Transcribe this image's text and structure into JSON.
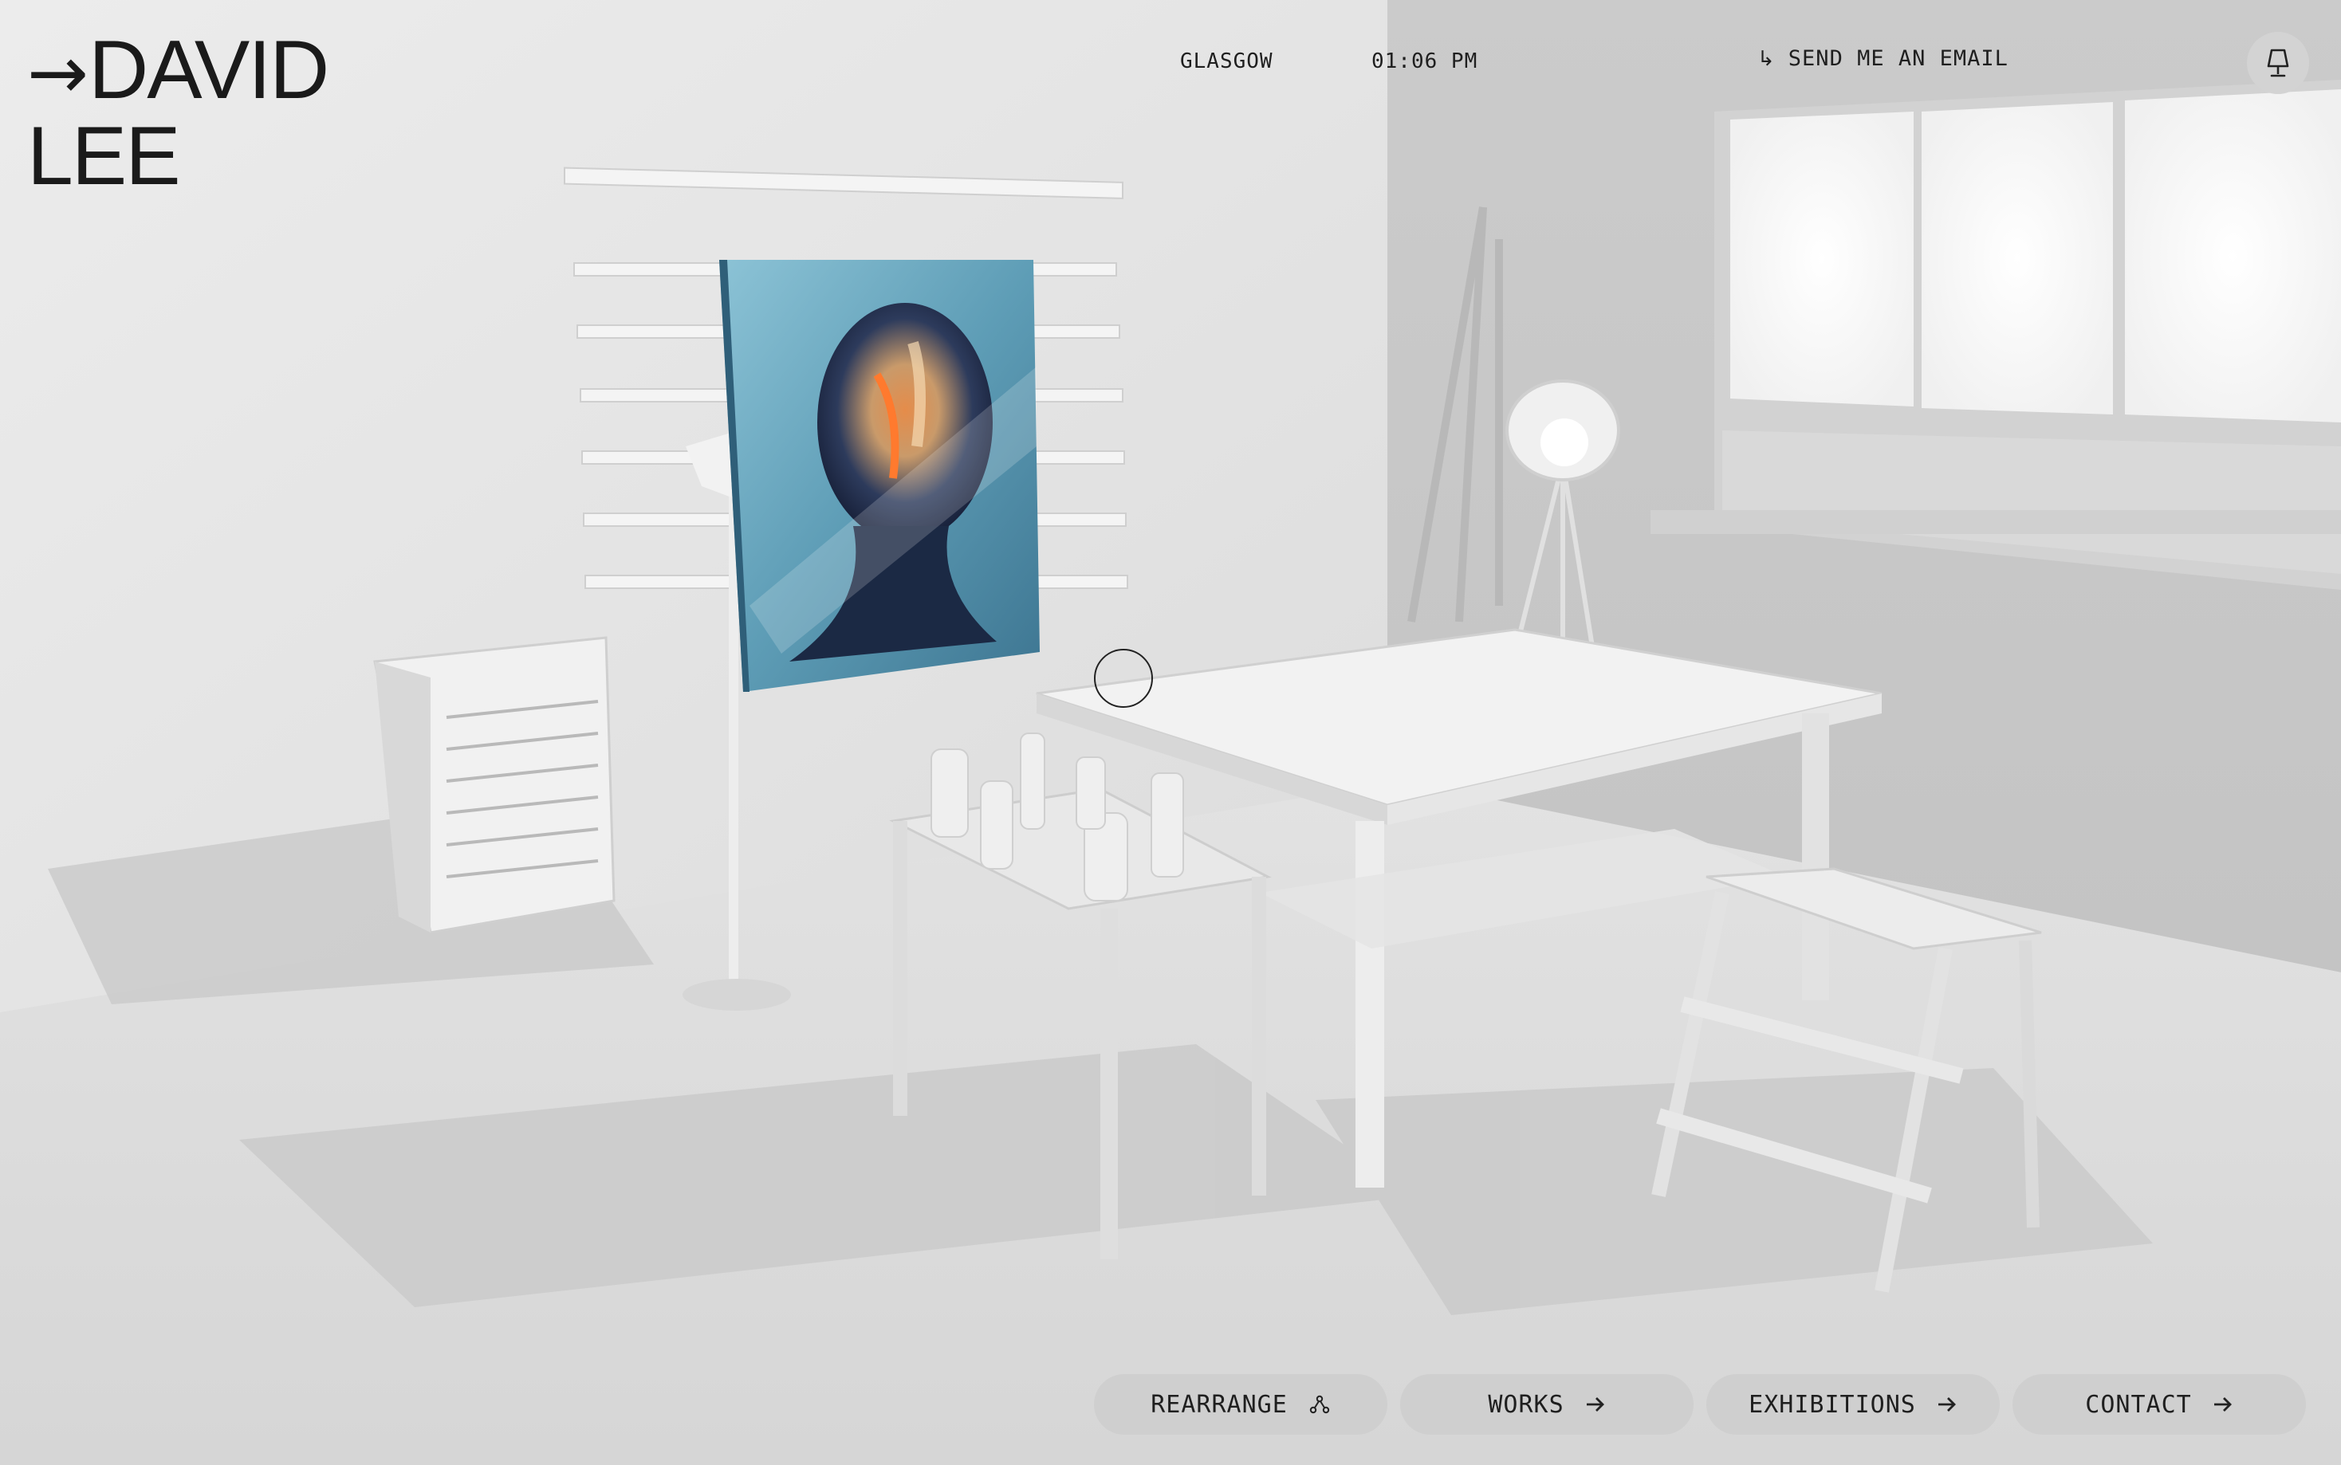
{
  "brand": {
    "arrow": "→",
    "name_line1": "DAVID",
    "name_line2": "LEE"
  },
  "header": {
    "city": "GLASGOW",
    "time": "01:06 PM",
    "email_icon": "↳",
    "email_label": "SEND ME AN EMAIL",
    "lamp_icon": "lamp-icon"
  },
  "nav": [
    {
      "label": "REARRANGE",
      "icon": "rearrange-icon"
    },
    {
      "label": "WORKS",
      "icon": "arrow-right-icon"
    },
    {
      "label": "EXHIBITIONS",
      "icon": "arrow-right-icon"
    },
    {
      "label": "CONTACT",
      "icon": "arrow-right-icon"
    }
  ],
  "colors": {
    "background": "#e9e9e9",
    "button": "#cfcfcf",
    "text": "#1a1a1a",
    "painting_blue": "#6fa9c2"
  }
}
